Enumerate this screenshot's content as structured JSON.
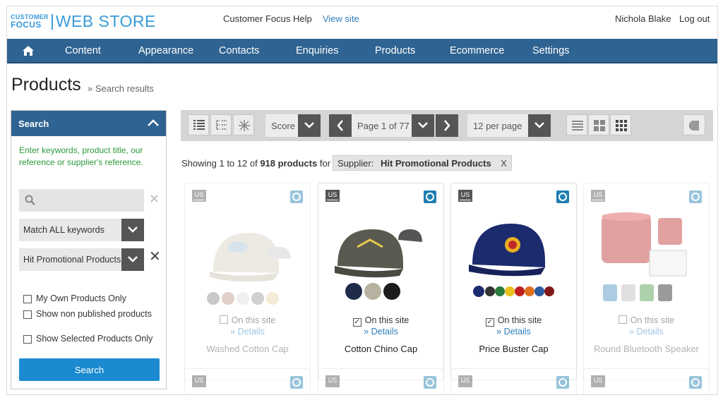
{
  "header": {
    "logo_top": "CUSTOMER",
    "logo_mid": "FOCUS",
    "logo_main": "WEB STORE",
    "help_link": "Customer Focus Help",
    "view_site": "View site",
    "user": "Nichola Blake",
    "logout": "Log out"
  },
  "nav": {
    "items": [
      "Content",
      "Appearance",
      "Contacts",
      "Enquiries",
      "Products",
      "Ecommerce",
      "Settings"
    ]
  },
  "page": {
    "title": "Products",
    "subtitle": "» Search results"
  },
  "search": {
    "heading": "Search",
    "help": "Enter keywords, product title, our reference or supplier's reference.",
    "input_placeholder": "",
    "match_mode": "Match ALL keywords",
    "supplier": "Hit Promotional Products",
    "options": [
      "My Own Products Only",
      "Show non published products",
      "Show Selected Products Only"
    ],
    "button": "Search"
  },
  "toolbar": {
    "sort": "Score",
    "page": "Page 1 of 77",
    "per_page": "12 per page"
  },
  "results": {
    "showing_prefix": "Showing 1 to 12 of ",
    "count": "918 products",
    "showing_suffix": " for",
    "filter_label": "Supplier:",
    "filter_value": "Hit Promotional Products",
    "filter_remove": "X"
  },
  "products": [
    {
      "name": "Washed Cotton Cap",
      "badge": "US",
      "on_site": "On this site",
      "details": "» Details",
      "checked": false
    },
    {
      "name": "Cotton Chino Cap",
      "badge": "US",
      "on_site": "On this site",
      "details": "» Details",
      "checked": true
    },
    {
      "name": "Price Buster Cap",
      "badge": "US",
      "on_site": "On this site",
      "details": "» Details",
      "checked": true
    },
    {
      "name": "Round Bluetooth Speaker",
      "badge": "US",
      "on_site": "On this site",
      "details": "» Details",
      "checked": false
    }
  ],
  "products_row2": [
    {
      "badge": "US"
    },
    {
      "badge": "US"
    },
    {
      "badge": "US"
    },
    {
      "badge": "US"
    }
  ],
  "colors": {
    "nav": "#2f6391",
    "accent": "#1b8ad0",
    "help_text": "#2a9a3c"
  }
}
